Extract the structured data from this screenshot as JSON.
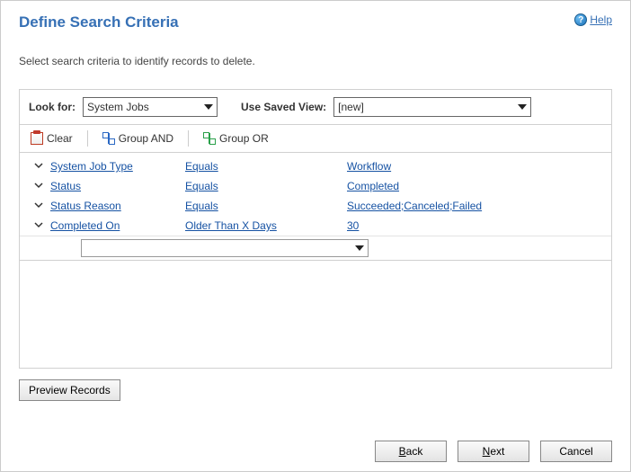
{
  "header": {
    "title": "Define Search Criteria",
    "help_label": "Help"
  },
  "instruction": "Select search criteria to identify records to delete.",
  "lookup": {
    "look_for_label": "Look for:",
    "look_for_value": "System Jobs",
    "saved_view_label": "Use Saved View:",
    "saved_view_value": "[new]"
  },
  "toolbar": {
    "clear_label": "Clear",
    "group_and_label": "Group AND",
    "group_or_label": "Group OR"
  },
  "filters": [
    {
      "field": "System Job Type",
      "operator": "Equals",
      "value": "Workflow"
    },
    {
      "field": "Status",
      "operator": "Equals",
      "value": "Completed"
    },
    {
      "field": "Status Reason",
      "operator": "Equals",
      "value": "Succeeded;Canceled;Failed"
    },
    {
      "field": "Completed On",
      "operator": "Older Than X Days",
      "value": "30"
    }
  ],
  "buttons": {
    "preview": "Preview Records",
    "back": "Back",
    "next": "Next",
    "cancel": "Cancel"
  }
}
